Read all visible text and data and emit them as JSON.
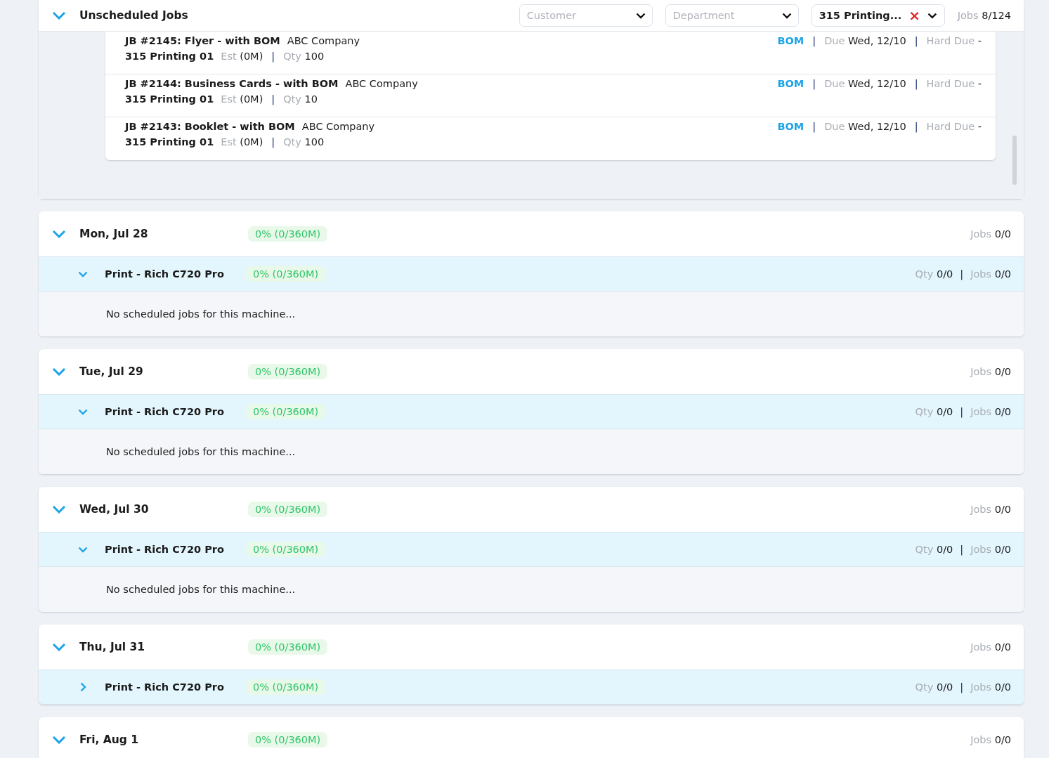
{
  "unscheduled": {
    "title": "Unscheduled Jobs",
    "expanded": true,
    "filters": [
      {
        "placeholder": "Customer"
      },
      {
        "placeholder": "Department"
      },
      {
        "value": "315 Printing...",
        "clear": "×"
      }
    ],
    "jobs_label": "Jobs",
    "jobs": "8/124",
    "jobs_list": [
      {
        "title": "JB #2145: Flyer - with BOM",
        "customer": "ABC Company",
        "machine": "315 Printing 01",
        "est_label": "Est",
        "est": "(0M)",
        "sep1": "|",
        "qty_label": "Qty",
        "qty": "100",
        "bom": "BOM",
        "sep2": "|",
        "due_label": "Due",
        "due": "Wed, 12/10",
        "sep3": "|",
        "hard_due_label": "Hard Due",
        "hard_due": "-"
      },
      {
        "title": "JB #2144: Business Cards - with BOM",
        "customer": "ABC Company",
        "machine": "315 Printing 01",
        "est_label": "Est",
        "est": "(0M)",
        "sep1": "|",
        "qty_label": "Qty",
        "qty": "10",
        "bom": "BOM",
        "sep2": "|",
        "due_label": "Due",
        "due": "Wed, 12/10",
        "sep3": "|",
        "hard_due_label": "Hard Due",
        "hard_due": "-"
      },
      {
        "title": "JB #2143: Booklet - with BOM",
        "customer": "ABC Company",
        "machine": "315 Printing 01",
        "est_label": "Est",
        "est": "(0M)",
        "sep1": "|",
        "qty_label": "Qty",
        "qty": "100",
        "bom": "BOM",
        "sep2": "|",
        "due_label": "Due",
        "due": "Wed, 12/10",
        "sep3": "|",
        "hard_due_label": "Hard Due",
        "hard_due": "-"
      }
    ]
  },
  "days": [
    {
      "date": "Mon, Jul 28",
      "expanded": true,
      "utilization": "0% (0/360M)",
      "jobs_label": "Jobs",
      "jobs": "0/0",
      "machines": [
        {
          "name": "Print - Rich C720 Pro",
          "expanded": true,
          "utilization": "0% (0/360M)",
          "qty_label": "Qty",
          "qty": "0/0",
          "sep": "|",
          "jobs_label": "Jobs",
          "jobs": "0/0",
          "empty_text": "No scheduled jobs for this machine..."
        }
      ]
    },
    {
      "date": "Tue, Jul 29",
      "expanded": true,
      "utilization": "0% (0/360M)",
      "jobs_label": "Jobs",
      "jobs": "0/0",
      "machines": [
        {
          "name": "Print - Rich C720 Pro",
          "expanded": true,
          "utilization": "0% (0/360M)",
          "qty_label": "Qty",
          "qty": "0/0",
          "sep": "|",
          "jobs_label": "Jobs",
          "jobs": "0/0",
          "empty_text": "No scheduled jobs for this machine..."
        }
      ]
    },
    {
      "date": "Wed, Jul 30",
      "expanded": true,
      "utilization": "0% (0/360M)",
      "jobs_label": "Jobs",
      "jobs": "0/0",
      "machines": [
        {
          "name": "Print - Rich C720 Pro",
          "expanded": true,
          "utilization": "0% (0/360M)",
          "qty_label": "Qty",
          "qty": "0/0",
          "sep": "|",
          "jobs_label": "Jobs",
          "jobs": "0/0",
          "empty_text": "No scheduled jobs for this machine..."
        }
      ]
    },
    {
      "date": "Thu, Jul 31",
      "expanded": true,
      "utilization": "0% (0/360M)",
      "jobs_label": "Jobs",
      "jobs": "0/0",
      "machines": [
        {
          "name": "Print - Rich C720 Pro",
          "expanded": false,
          "utilization": "0% (0/360M)",
          "qty_label": "Qty",
          "qty": "0/0",
          "sep": "|",
          "jobs_label": "Jobs",
          "jobs": "0/0"
        }
      ]
    },
    {
      "date": "Fri, Aug 1",
      "expanded": true,
      "utilization": "0% (0/360M)",
      "jobs_label": "Jobs",
      "jobs": "0/0"
    }
  ]
}
